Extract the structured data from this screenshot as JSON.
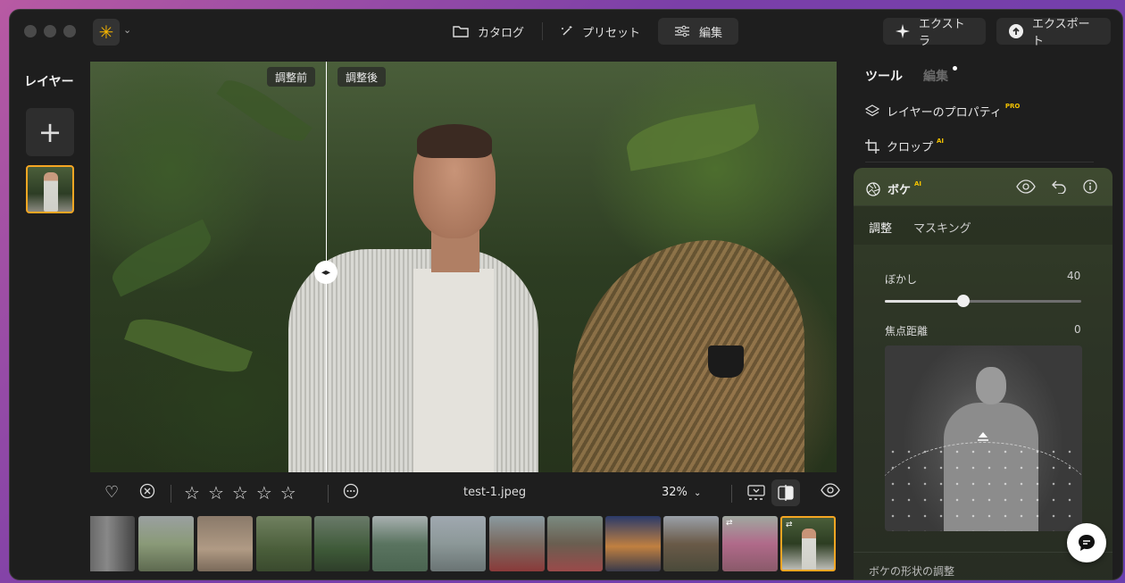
{
  "header": {
    "tabs": [
      {
        "label": "カタログ",
        "icon": "folder-icon"
      },
      {
        "label": "プリセット",
        "icon": "magic-wand-icon"
      },
      {
        "label": "編集",
        "icon": "sliders-icon",
        "active": true
      }
    ],
    "extra_label": "エクストラ",
    "export_label": "エクスポート"
  },
  "layers": {
    "title": "レイヤー",
    "add_label": "+"
  },
  "canvas": {
    "before_label": "調整前",
    "after_label": "調整後"
  },
  "toolbar": {
    "filename": "test-1.jpeg",
    "zoom": "32%",
    "rating_stars": 5
  },
  "right_panel": {
    "tab_tools": "ツール",
    "tab_edit": "編集",
    "layer_props": "レイヤーのプロパティ",
    "layer_props_badge": "PRO",
    "crop": "クロップ",
    "crop_badge": "AI",
    "bokeh": {
      "title": "ボケ",
      "badge": "AI",
      "sub_tab_adjust": "調整",
      "sub_tab_masking": "マスキング",
      "blur_label": "ぼかし",
      "blur_value": "40",
      "blur_fraction": 0.4,
      "focus_label": "焦点距離",
      "focus_value": "0",
      "shape_label": "ボケの形状の調整"
    }
  },
  "colors": {
    "accent": "#f5a623",
    "pro_badge": "#f5c400"
  }
}
